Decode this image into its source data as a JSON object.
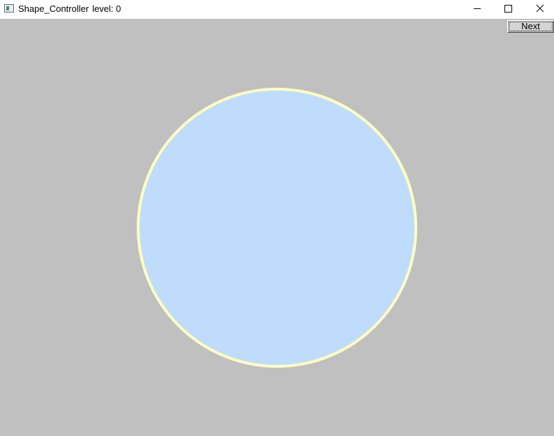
{
  "window": {
    "app_name": "Shape_Controller",
    "level_text": "level: 0"
  },
  "controls": {
    "next_label": "Next"
  },
  "shape": {
    "type": "circle",
    "fill": "#c0dcfc",
    "stroke": "#ffffc0",
    "background": "#c0c0c0"
  }
}
